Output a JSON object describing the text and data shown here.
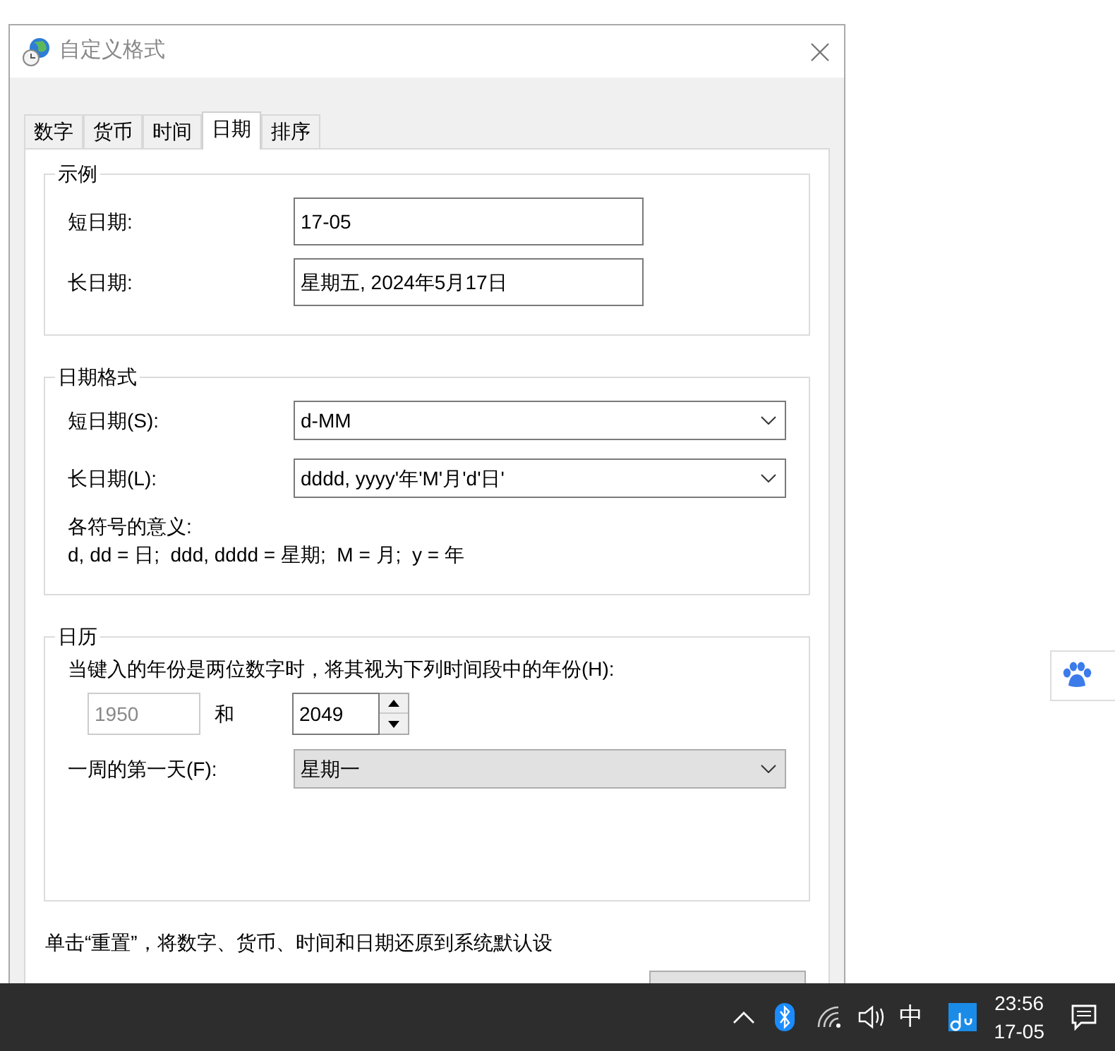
{
  "window": {
    "title": "自定义格式"
  },
  "tabs": [
    {
      "label": "数字",
      "selected": false
    },
    {
      "label": "货币",
      "selected": false
    },
    {
      "label": "时间",
      "selected": false
    },
    {
      "label": "日期",
      "selected": true
    },
    {
      "label": "排序",
      "selected": false
    }
  ],
  "sample": {
    "title": "示例",
    "rows": [
      {
        "label": "短日期:",
        "value": "17-05"
      },
      {
        "label": "长日期:",
        "value": "星期五, 2024年5月17日"
      }
    ]
  },
  "date_formats": {
    "title": "日期格式",
    "rows": [
      {
        "label": "短日期(S):",
        "value": "d-MM"
      },
      {
        "label": "长日期(L):",
        "value": "dddd, yyyy'年'M'月'd'日'"
      }
    ],
    "legend_title": "各符号的意义:",
    "legend": "d, dd = 日;  ddd, dddd = 星期;  M = 月;  y = 年"
  },
  "calendar": {
    "title": "日历",
    "two_digit_label": "当键入的年份是两位数字时，将其视为下列时间段中的年份(H):",
    "start_year": {
      "value": "1950",
      "disabled": true
    },
    "and_label": "和",
    "end_year": {
      "value": "2049",
      "disabled": false
    },
    "first_day": {
      "label": "一周的第一天(F):",
      "value": "星期一"
    }
  },
  "footer_text": "单击“重置”，将数字、货币、时间和日期还原到系统默认设",
  "taskbar": {
    "ime": "中",
    "clock_time": "23:56",
    "clock_date": "17-05"
  }
}
